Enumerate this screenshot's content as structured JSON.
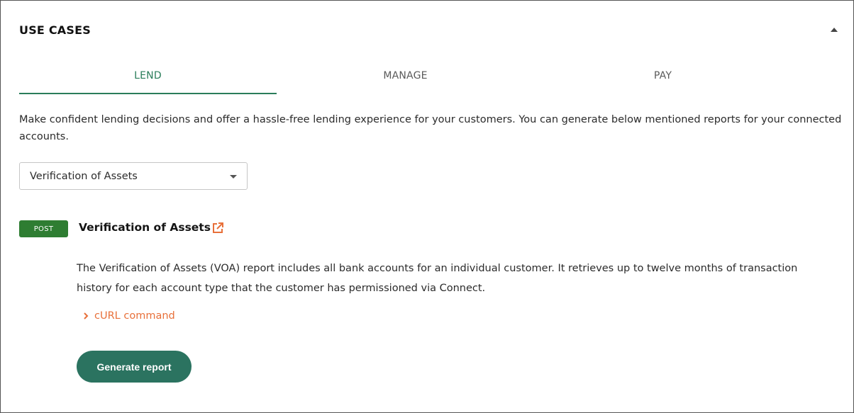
{
  "section": {
    "title": "USE CASES"
  },
  "tabs": [
    {
      "label": "LEND",
      "active": true
    },
    {
      "label": "MANAGE",
      "active": false
    },
    {
      "label": "PAY",
      "active": false
    }
  ],
  "lend": {
    "description": "Make confident lending decisions and offer a hassle-free lending experience for your customers. You can generate below mentioned reports for your connected accounts.",
    "report_select": {
      "selected": "Verification of Assets"
    },
    "endpoint": {
      "method": "POST",
      "title": "Verification of Assets",
      "description": "The Verification of Assets (VOA) report includes all bank accounts for an individual customer. It retrieves up to twelve months of transaction history for each account type that the customer has permissioned via Connect.",
      "curl_label": "cURL command",
      "generate_label": "Generate report"
    }
  },
  "icons": {
    "collapse": "caret-up-icon",
    "select_caret": "caret-down-icon",
    "external": "external-link-icon",
    "curl": "chevron-right-icon"
  },
  "colors": {
    "accent": "#2a7d5a",
    "badge": "#2e7d32",
    "link": "#e8703a",
    "button": "#2b7360"
  }
}
